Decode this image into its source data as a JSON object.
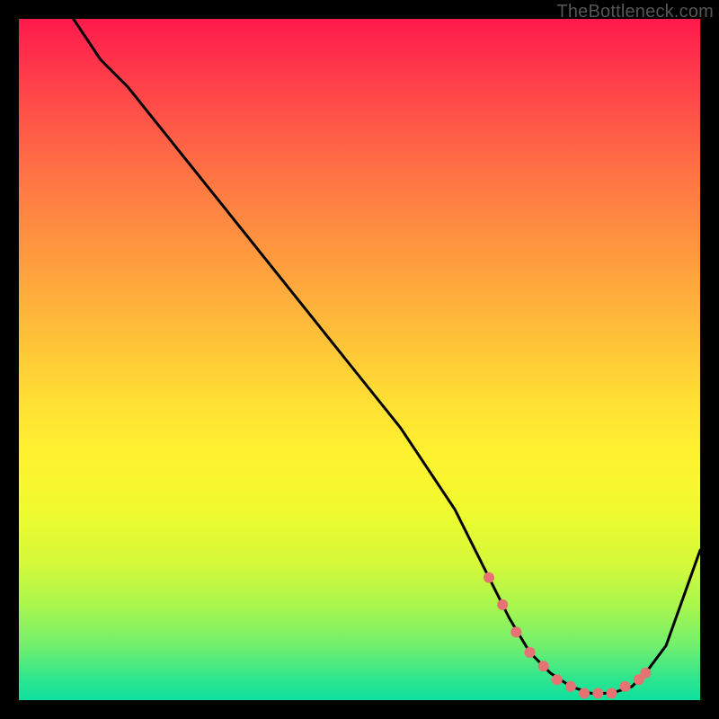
{
  "watermark": "TheBottleneck.com",
  "chart_data": {
    "type": "line",
    "title": "",
    "xlabel": "",
    "ylabel": "",
    "xlim": [
      0,
      100
    ],
    "ylim": [
      0,
      100
    ],
    "series": [
      {
        "name": "bottleneck-curve",
        "x": [
          8,
          10,
          12,
          16,
          24,
          32,
          40,
          48,
          56,
          64,
          69,
          72,
          75,
          78,
          81,
          84,
          87,
          90,
          92,
          95,
          100
        ],
        "values": [
          100,
          97,
          94,
          90,
          80,
          70,
          60,
          50,
          40,
          28,
          18,
          12,
          7,
          4,
          2,
          1,
          1,
          2,
          4,
          8,
          22
        ]
      }
    ],
    "plateau_markers": {
      "name": "plateau-dots",
      "x": [
        69,
        71,
        73,
        75,
        77,
        79,
        81,
        83,
        85,
        87,
        89,
        91,
        92
      ],
      "values": [
        18,
        14,
        10,
        7,
        5,
        3,
        2,
        1,
        1,
        1,
        2,
        3,
        4
      ]
    },
    "colors": {
      "curve": "#000000",
      "marker": "#e57373",
      "gradient_top": "#ff1a4d",
      "gradient_bottom": "#0ee09e"
    }
  }
}
